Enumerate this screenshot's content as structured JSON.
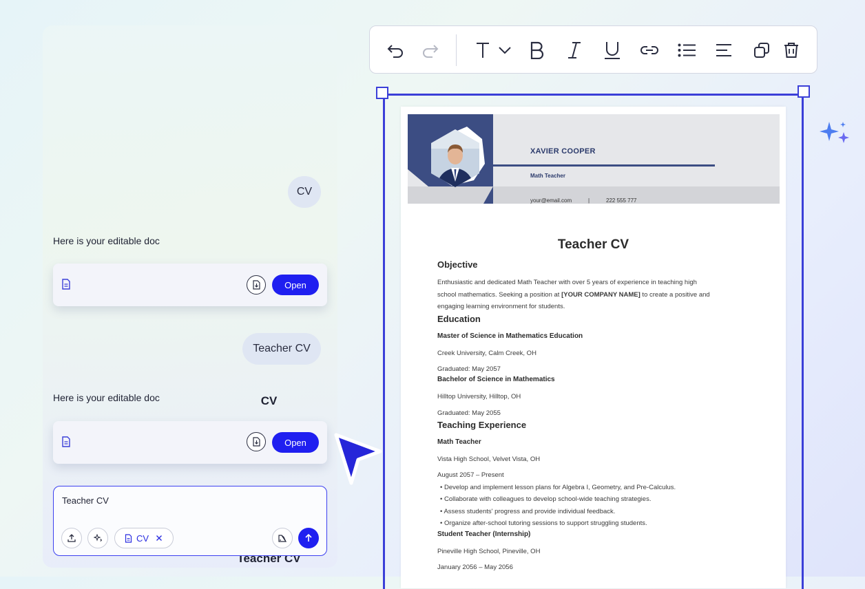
{
  "chat": {
    "messages": [
      {
        "role": "user",
        "text": "CV"
      },
      {
        "role": "assistant",
        "text": "Here is your editable doc",
        "doc_title": "CV",
        "open_label": "Open"
      },
      {
        "role": "user",
        "text": "Teacher CV"
      },
      {
        "role": "assistant",
        "text": "Here is your editable doc",
        "doc_title": "Teacher CV",
        "open_label": "Open"
      }
    ],
    "composer": {
      "value": "Teacher CV",
      "attachment_label": "CV"
    }
  },
  "toolbar": {
    "icons": [
      "undo-icon",
      "redo-icon",
      "text-style-icon",
      "bold-icon",
      "italic-icon",
      "underline-icon",
      "link-icon",
      "list-icon",
      "align-icon",
      "duplicate-icon",
      "delete-icon"
    ]
  },
  "document": {
    "header": {
      "name": "XAVIER COOPER",
      "role": "Math Teacher",
      "email": "your@email.com",
      "separator": "|",
      "phone": "222 555 777"
    },
    "title": "Teacher CV",
    "objective": {
      "heading": "Objective",
      "line1": "Enthusiastic and dedicated Math Teacher with over 5 years of experience in teaching high",
      "line2_pre": "school mathematics. Seeking a position at ",
      "line2_bold": "[YOUR COMPANY NAME]",
      "line2_post": " to create a positive and",
      "line3": "engaging learning environment for students."
    },
    "education": {
      "heading": "Education",
      "items": [
        {
          "degree": "Master of Science in Mathematics Education",
          "school": "Creek University, Calm Creek, OH",
          "date": "Graduated: May 2057"
        },
        {
          "degree": "Bachelor of Science in Mathematics",
          "school": "Hilltop University, Hilltop, OH",
          "date": "Graduated: May 2055"
        }
      ]
    },
    "experience": {
      "heading": "Teaching Experience",
      "jobs": [
        {
          "title": "Math Teacher",
          "place": "Vista High School, Velvet Vista, OH",
          "dates": "August 2057 – Present",
          "bullets": [
            "Develop and implement lesson plans for Algebra I, Geometry, and Pre-Calculus.",
            "Collaborate with colleagues to develop school-wide teaching strategies.",
            "Assess students' progress and provide individual feedback.",
            "Organize after-school tutoring sessions to support struggling students."
          ]
        },
        {
          "title": "Student Teacher (Internship)",
          "place": "Pineville High School, Pineville, OH",
          "dates": "January 2056 – May 2056"
        }
      ]
    }
  },
  "colors": {
    "accent": "#1f1ff0",
    "selection": "#3b3fd8",
    "header_blue": "#3c4d83"
  }
}
